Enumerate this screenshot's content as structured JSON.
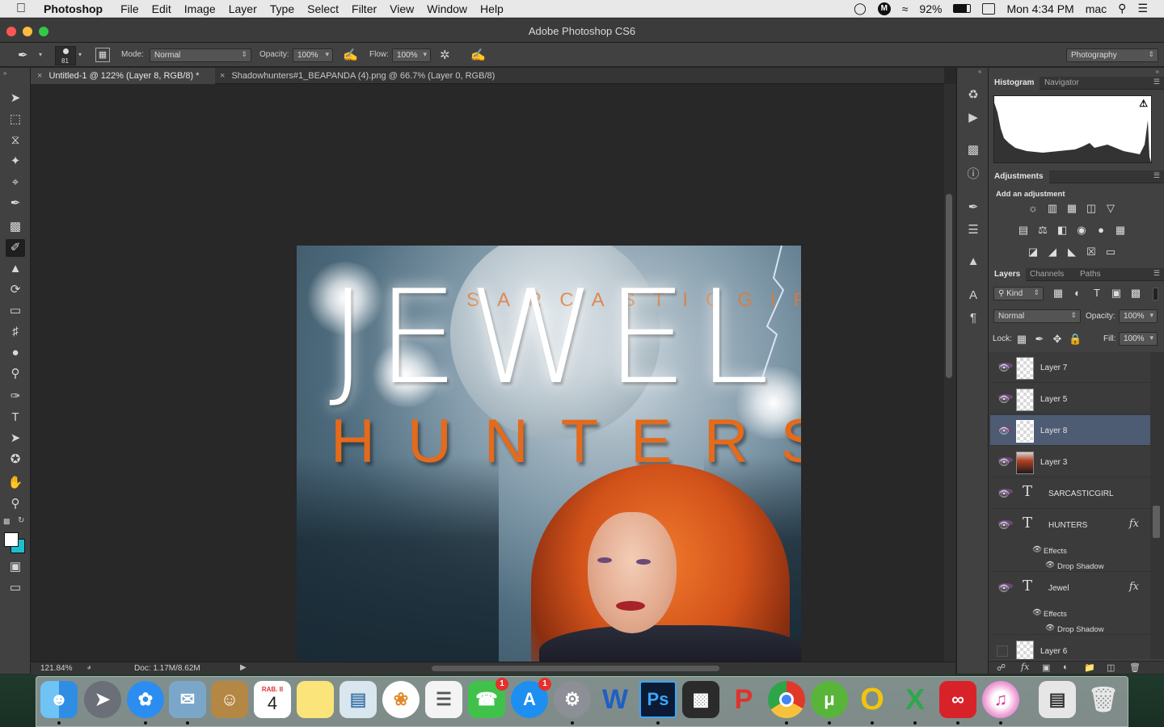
{
  "menubar": {
    "app_name": "Photoshop",
    "items": [
      "File",
      "Edit",
      "Image",
      "Layer",
      "Type",
      "Select",
      "Filter",
      "View",
      "Window",
      "Help"
    ],
    "battery": "92%",
    "datetime": "Mon 4:34 PM",
    "user": "mac"
  },
  "window": {
    "title": "Adobe Photoshop CS6"
  },
  "options": {
    "brush_size": "81",
    "mode_label": "Mode:",
    "mode_value": "Normal",
    "opacity_label": "Opacity:",
    "opacity_value": "100%",
    "flow_label": "Flow:",
    "flow_value": "100%",
    "workspace": "Photography"
  },
  "tabs": [
    {
      "label": "Untitled-1 @ 122% (Layer 8, RGB/8) *"
    },
    {
      "label": "Shadowhunters#1_BEAPANDA (4).png @ 66.7% (Layer 0, RGB/8)"
    }
  ],
  "artwork": {
    "title_word": "JEWEL",
    "subtitle_word": "HUNTERS",
    "author": "SARCASTICGIRL"
  },
  "status": {
    "zoom": "121.84%",
    "doc": "Doc: 1.17M/8.62M"
  },
  "panels": {
    "histogram_tabs": [
      "Histogram",
      "Navigator"
    ],
    "adjustments_tab": "Adjustments",
    "adjustments_heading": "Add an adjustment",
    "layers_tabs": [
      "Layers",
      "Channels",
      "Paths"
    ],
    "filter_kind": "Kind",
    "blend_mode": "Normal",
    "opacity_label": "Opacity:",
    "opacity_value": "100%",
    "lock_label": "Lock:",
    "fill_label": "Fill:",
    "fill_value": "100%",
    "effects_label": "Effects",
    "drop_shadow_label": "Drop Shadow",
    "layers": [
      {
        "name": "Layer 7"
      },
      {
        "name": "Layer 5"
      },
      {
        "name": "Layer 8"
      },
      {
        "name": "Layer 3"
      },
      {
        "name": "SARCASTICGIRL"
      },
      {
        "name": "HUNTERS"
      },
      {
        "name": "Jewel"
      },
      {
        "name": "Layer 6"
      }
    ]
  },
  "dock": {
    "calendar_month": "RAB. II",
    "calendar_day": "4",
    "facetime_badge": "1",
    "appstore_badge": "1",
    "ps_label": "Ps",
    "word_label": "W",
    "apps": [
      "finder-icon",
      "launchpad-icon",
      "safari-icon",
      "mail-icon",
      "contacts-icon",
      "calendar-icon",
      "notes-icon",
      "preview-icon",
      "photos-icon",
      "reminders-icon",
      "facetime-icon",
      "app-store-icon",
      "system-preferences-icon",
      "word-icon",
      "photoshop-icon",
      "final-cut-icon",
      "wps-icon",
      "chrome-icon",
      "utorrent-icon",
      "opera-icon",
      "excel-icon",
      "creative-cloud-icon",
      "itunes-icon",
      "screenshot-icon",
      "trash-icon"
    ]
  }
}
